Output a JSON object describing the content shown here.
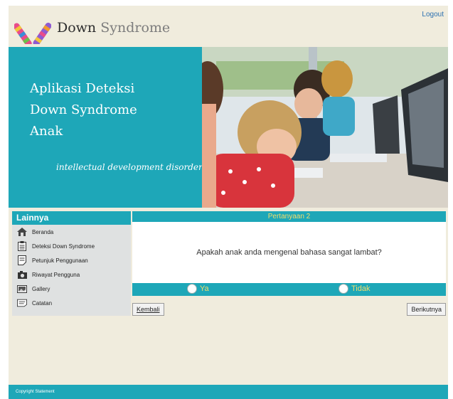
{
  "header": {
    "logo_part1": "Down",
    "logo_part2": "Syndrome",
    "logout": "Logout"
  },
  "banner": {
    "title": "Aplikasi Deteksi\nDown Syndrome\nAnak",
    "subtitle": "intellectual development disorder"
  },
  "sidebar": {
    "heading": "Lainnya",
    "items": [
      {
        "label": "Beranda",
        "icon": "home-icon"
      },
      {
        "label": "Deteksi Down Syndrome",
        "icon": "clipboard-icon"
      },
      {
        "label": "Petunjuk Penggunaan",
        "icon": "note-icon"
      },
      {
        "label": "Riwayat Pengguna",
        "icon": "camera-icon"
      },
      {
        "label": "Gallery",
        "icon": "gallery-icon"
      },
      {
        "label": "Catatan",
        "icon": "notes-icon"
      }
    ]
  },
  "question": {
    "heading": "Pertanyaan 2",
    "text": "Apakah anak anda mengenal bahasa sangat lambat?",
    "options": [
      "Ya",
      "Tidak"
    ]
  },
  "buttons": {
    "back": "Kembali",
    "next": "Berikutnya"
  },
  "footer": {
    "copyright": "Copyright Statement"
  },
  "colors": {
    "teal": "#1ea7b8",
    "page_bg": "#f0ecdd",
    "option_text": "#f4dc6b"
  }
}
